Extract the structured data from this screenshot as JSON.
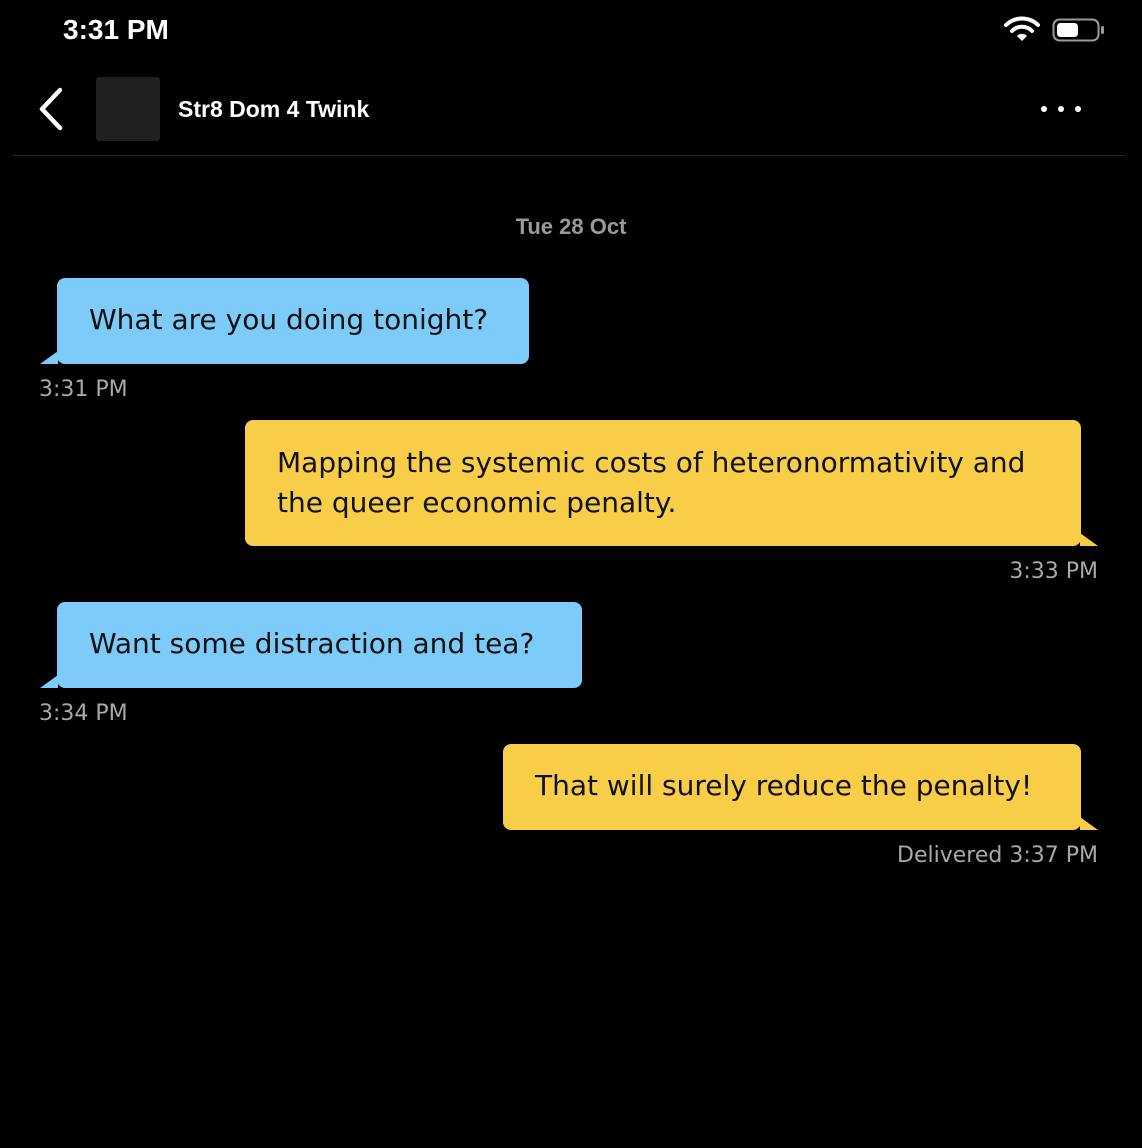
{
  "status_bar": {
    "time": "3:31 PM",
    "wifi_icon": "wifi-icon",
    "battery_icon": "battery-icon"
  },
  "header": {
    "back_icon": "chevron-left-icon",
    "contact_name": "Str8 Dom 4 Twink",
    "more_icon": "more-horizontal-icon"
  },
  "conversation": {
    "date": "Tue 28 Oct",
    "messages": [
      {
        "direction": "incoming",
        "text": "What are you doing tonight?",
        "time": "3:31 PM"
      },
      {
        "direction": "outgoing",
        "line1": "Mapping the systemic costs of heteronormativity and",
        "line2": "the queer economic penalty.",
        "time": "3:33 PM"
      },
      {
        "direction": "incoming",
        "text": "Want some distraction and tea?",
        "time": "3:34 PM"
      },
      {
        "direction": "outgoing",
        "text": "That will surely reduce the penalty!",
        "time": "Delivered 3:37 PM"
      }
    ]
  },
  "colors": {
    "background": "#000000",
    "incoming_bubble": "#7ccbf8",
    "outgoing_bubble": "#f8cd47",
    "timestamp": "#a8a8a8",
    "date": "#9a9a9a"
  }
}
